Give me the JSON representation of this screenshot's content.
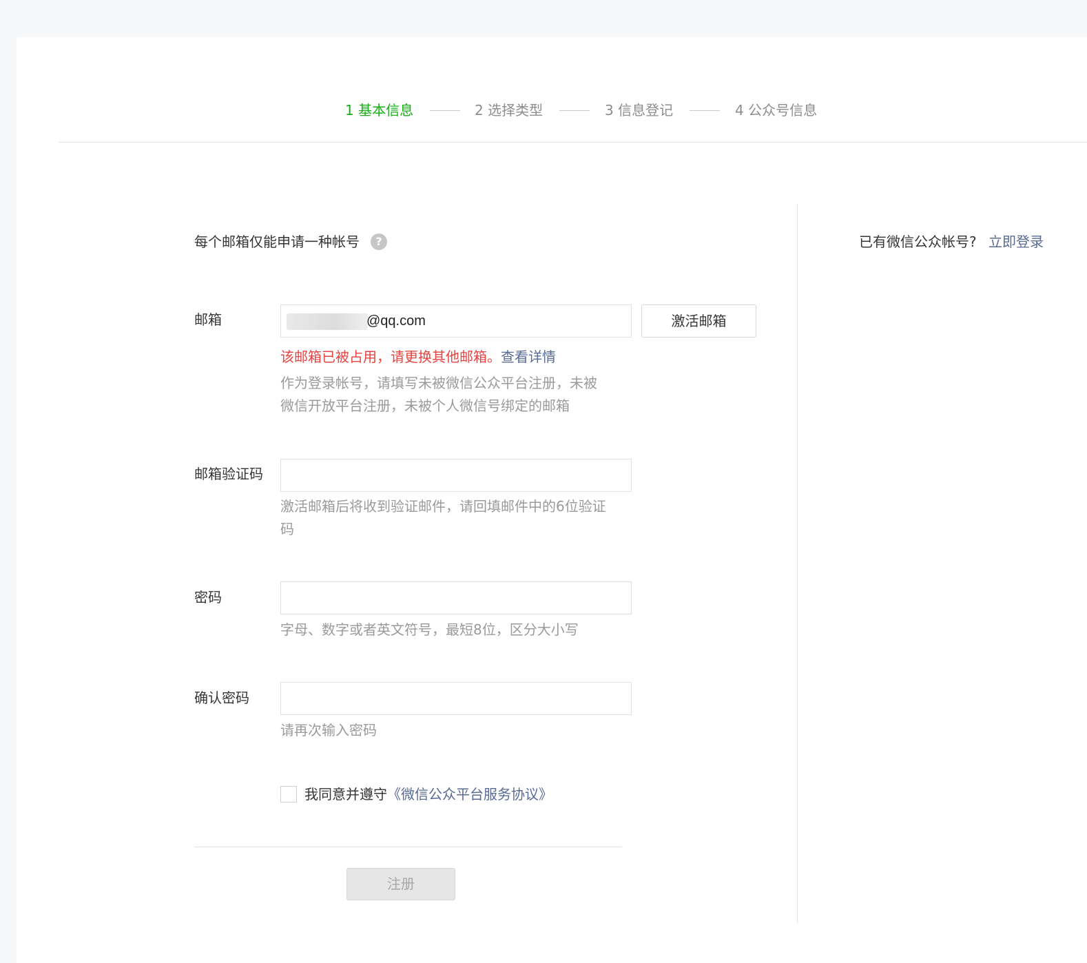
{
  "steps": [
    {
      "label": "1 基本信息",
      "state": "active"
    },
    {
      "label": "2 选择类型",
      "state": "pending"
    },
    {
      "label": "3 信息登记",
      "state": "pending"
    },
    {
      "label": "4 公众号信息",
      "state": "pending"
    }
  ],
  "notice": {
    "text": "每个邮箱仅能申请一种帐号",
    "help_icon": "question-circle-icon"
  },
  "login_prompt": {
    "text": "已有微信公众帐号?",
    "link": "立即登录"
  },
  "form": {
    "email": {
      "label": "邮箱",
      "value": "@qq.com",
      "activate_button": "激活邮箱",
      "error": "该邮箱已被占用，请更换其他邮箱。",
      "error_link": "查看详情",
      "tip": "作为登录帐号，请填写未被微信公众平台注册，未被微信开放平台注册，未被个人微信号绑定的邮箱"
    },
    "code": {
      "label": "邮箱验证码",
      "value": "",
      "tip": "激活邮箱后将收到验证邮件，请回填邮件中的6位验证码"
    },
    "password": {
      "label": "密码",
      "value": "",
      "tip": "字母、数字或者英文符号，最短8位，区分大小写"
    },
    "confirm": {
      "label": "确认密码",
      "value": "",
      "tip": "请再次输入密码"
    },
    "agreement": {
      "text": "我同意并遵守",
      "link": "《微信公众平台服务协议》",
      "checked": false
    },
    "submit": "注册"
  },
  "colors": {
    "accent": "#1aad19",
    "link": "#576b95",
    "error": "#e64340"
  }
}
